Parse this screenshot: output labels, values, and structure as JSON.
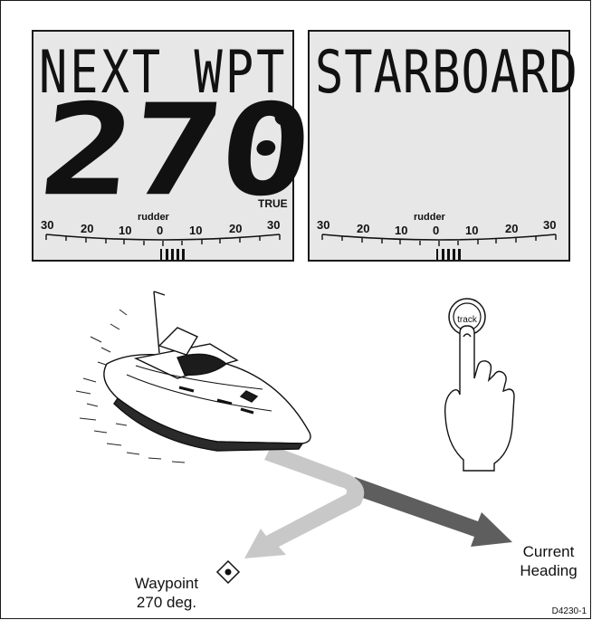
{
  "left_display": {
    "title": "NEXT WPT",
    "heading_value": "270",
    "degree_symbol": "°",
    "reference": "TRUE"
  },
  "right_display": {
    "title": "STARBOARD"
  },
  "rudder_scale": {
    "label": "rudder",
    "ticks": [
      "30",
      "20",
      "10",
      "0",
      "10",
      "20",
      "30"
    ]
  },
  "track_button": {
    "label": "track"
  },
  "waypoint_label": [
    "Waypoint",
    "270 deg."
  ],
  "current_heading_label": [
    "Current",
    "Heading"
  ],
  "figure_id": "D4230-1"
}
